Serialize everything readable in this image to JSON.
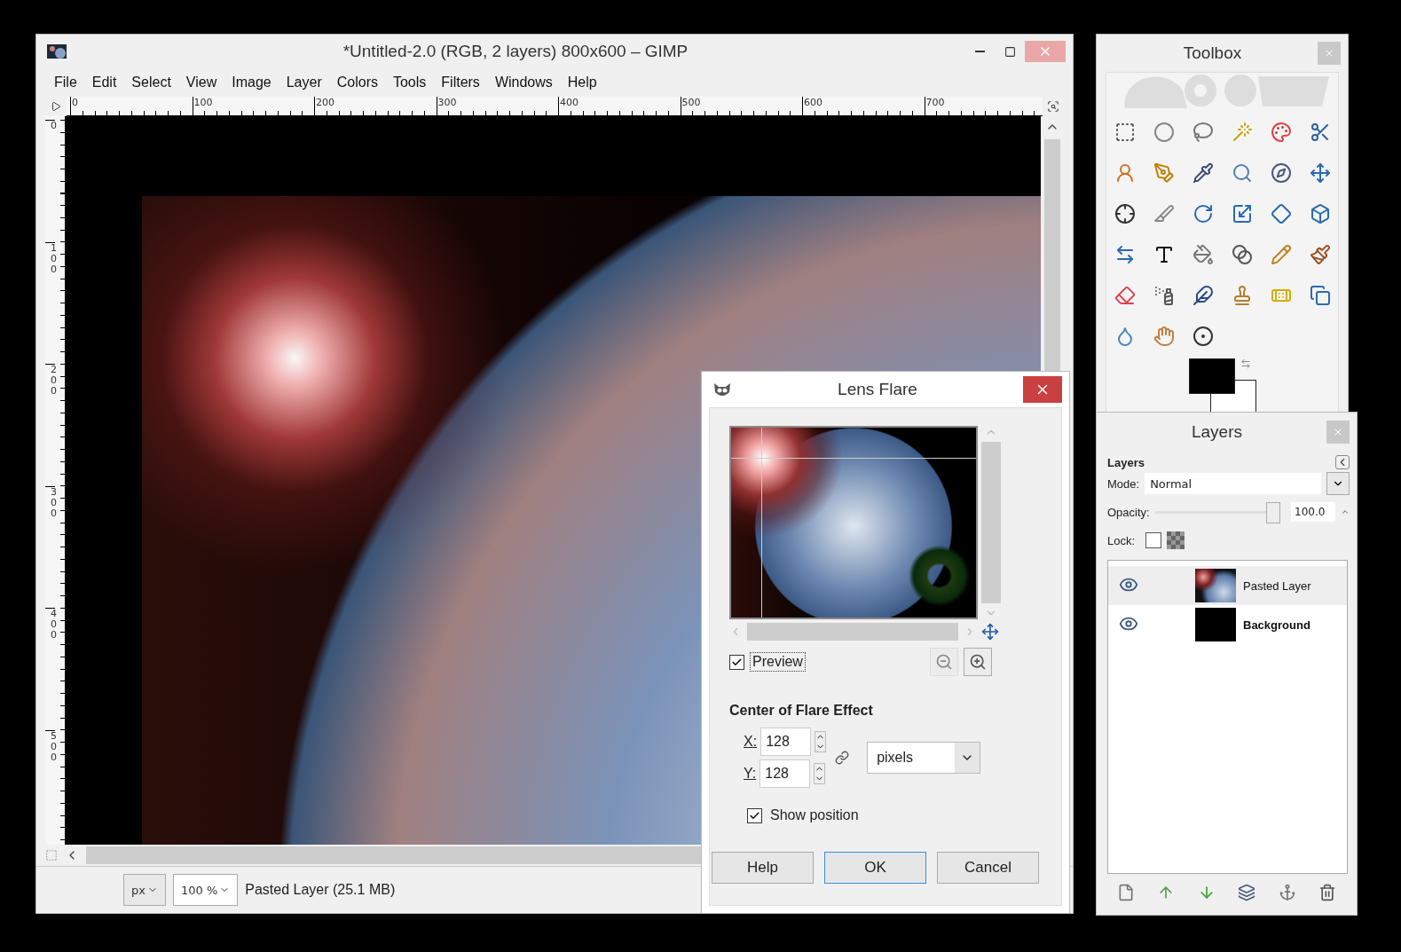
{
  "main_window": {
    "title": "*Untitled-2.0 (RGB, 2 layers) 800x600 – GIMP",
    "menu": [
      "File",
      "Edit",
      "Select",
      "View",
      "Image",
      "Layer",
      "Colors",
      "Tools",
      "Filters",
      "Windows",
      "Help"
    ],
    "ruler_h": [
      "0",
      "100",
      "200",
      "300",
      "400",
      "500",
      "600",
      "700"
    ],
    "ruler_v": [
      "0",
      "100",
      "200",
      "300",
      "400",
      "500"
    ],
    "status": {
      "unit": "px",
      "zoom": "100 %",
      "info": "Pasted Layer (25.1 MB)"
    }
  },
  "toolbox": {
    "title": "Toolbox"
  },
  "layers_dock": {
    "title": "Layers",
    "tab": "Layers",
    "mode_label": "Mode:",
    "mode": "Normal",
    "opacity_label": "Opacity:",
    "opacity": {
      "level": 1,
      "reading": "100.0"
    },
    "lock_label": "Lock:",
    "lock_pixels": false,
    "layers": [
      {
        "name": "Pasted Layer",
        "visible": true,
        "selected": true,
        "bold": false,
        "kind": "image"
      },
      {
        "name": "Background",
        "visible": true,
        "selected": false,
        "bold": true,
        "kind": "fill"
      }
    ]
  },
  "dialog": {
    "title": "Lens Flare",
    "preview": {
      "label": "Preview",
      "checked": true
    },
    "section": "Center of Flare Effect",
    "x": {
      "label": "X:",
      "value": "128"
    },
    "y": {
      "label": "Y:",
      "value": "128"
    },
    "unit": "pixels",
    "show_position": {
      "label": "Show position",
      "checked": true
    },
    "buttons": [
      {
        "label": "Help",
        "default": false
      },
      {
        "label": "OK",
        "default": true
      },
      {
        "label": "Cancel",
        "default": false
      }
    ]
  }
}
